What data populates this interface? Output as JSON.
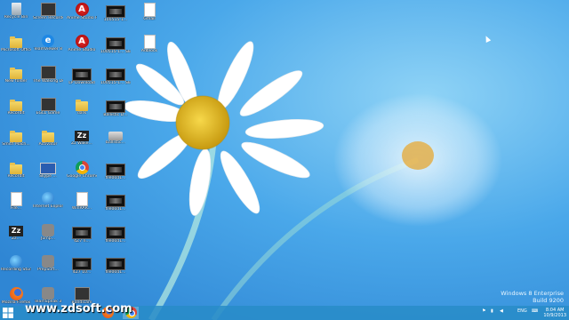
{
  "desktop": {
    "icons": [
      {
        "label": "Recycle Bin",
        "type": "recycle"
      },
      {
        "label": "Screen Recorder",
        "type": "app-dark"
      },
      {
        "label": "Anime Studio Pro",
        "type": "red-round"
      },
      {
        "label": "100515-1...",
        "type": "vid"
      },
      {
        "label": "Gmail",
        "type": "doc"
      },
      {
        "label": "Microsoft Office",
        "type": "folder"
      },
      {
        "label": "TeamViewer 8",
        "type": "blue-e"
      },
      {
        "label": "Anime Studio",
        "type": "red-round"
      },
      {
        "label": "100515-1... Skeletor",
        "type": "vid"
      },
      {
        "label": "Adblock",
        "type": "doc"
      },
      {
        "label": "New folder",
        "type": "folder"
      },
      {
        "label": "The Walking Dead",
        "type": "app-dark"
      },
      {
        "label": "LP Download",
        "type": "vid"
      },
      {
        "label": "100515-1... Skeletor",
        "type": "vid"
      },
      {
        "label": "RecordIt",
        "type": "folder"
      },
      {
        "label": "EGLL Game",
        "type": "app-dark"
      },
      {
        "label": "dark",
        "type": "folder"
      },
      {
        "label": "Ballistic D...",
        "type": "vid"
      },
      {
        "label": "Smith Mach...",
        "type": "folder"
      },
      {
        "label": "Activator",
        "type": "folder"
      },
      {
        "label": "Zz Wake...",
        "type": "zz"
      },
      {
        "label": "ballistic...",
        "type": "drive"
      },
      {
        "label": "RecordIt",
        "type": "folder"
      },
      {
        "label": "Skype ...",
        "type": "monitor"
      },
      {
        "label": "Google Chrome",
        "type": "chrome"
      },
      {
        "label": "file0041...",
        "type": "vid"
      },
      {
        "label": "File...",
        "type": "doc"
      },
      {
        "label": "Internet Explorer",
        "type": "globe"
      },
      {
        "label": "WinRAR...",
        "type": "doc"
      },
      {
        "label": "file0041...",
        "type": "vid"
      },
      {
        "label": "Zz...",
        "type": "zz"
      },
      {
        "label": "Jump...",
        "type": "gear"
      },
      {
        "label": "4Z7 n...",
        "type": "vid"
      },
      {
        "label": "file0041...",
        "type": "vid"
      },
      {
        "label": "Recording Studio",
        "type": "globe"
      },
      {
        "label": "PrepSoft...",
        "type": "gear"
      },
      {
        "label": "4Z7 10...",
        "type": "vid"
      },
      {
        "label": "file0041...",
        "type": "vid"
      },
      {
        "label": "Mozilla Firefox",
        "type": "firefox"
      },
      {
        "label": "TeamSpeak 3",
        "type": "gear"
      },
      {
        "label": "Bandicam",
        "type": "app-dark"
      }
    ]
  },
  "watermark": {
    "line1": "Windows 8 Enterprise",
    "line2": "Build 9200"
  },
  "taskbar": {
    "site": "www.zdsoft.com",
    "tray_lang": "ENG",
    "time": "8:04 AM",
    "date": "10/9/2013"
  },
  "colors": {
    "sky_top": "#3f9fe6",
    "sky_bottom": "#7fc8f2",
    "petal": "#ffffff",
    "center": "#f2c318",
    "taskbar": "#2f8fd0"
  }
}
